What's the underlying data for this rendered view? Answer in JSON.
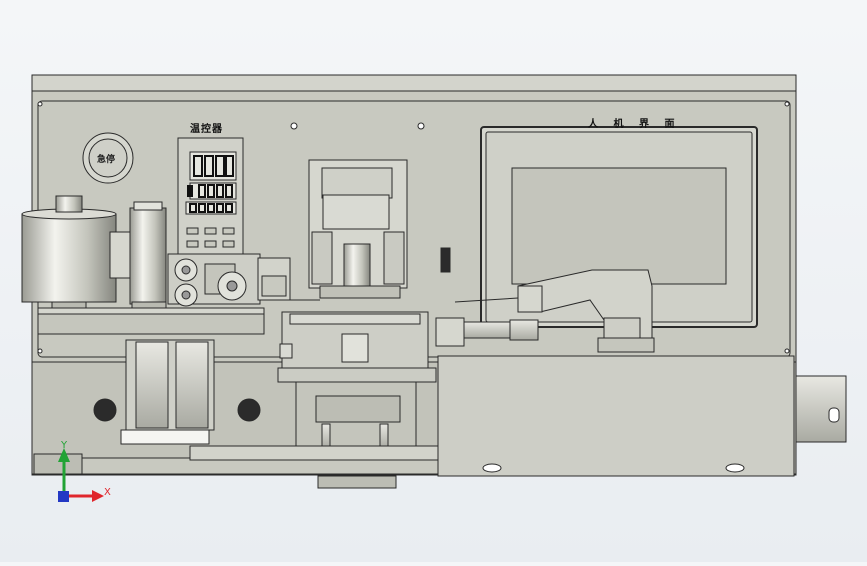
{
  "labels": {
    "hmi": "人 机 界 面",
    "temp_controller": "温控器",
    "estop": "急停"
  },
  "axes": {
    "y": "Y",
    "x": "X"
  },
  "colors": {
    "background": "#f0f3f6",
    "panel": "#c8c9c0",
    "line": "#2a2a2a",
    "axis_x": "#e0262d",
    "axis_y": "#21a335",
    "axis_z": "#2338c4"
  }
}
